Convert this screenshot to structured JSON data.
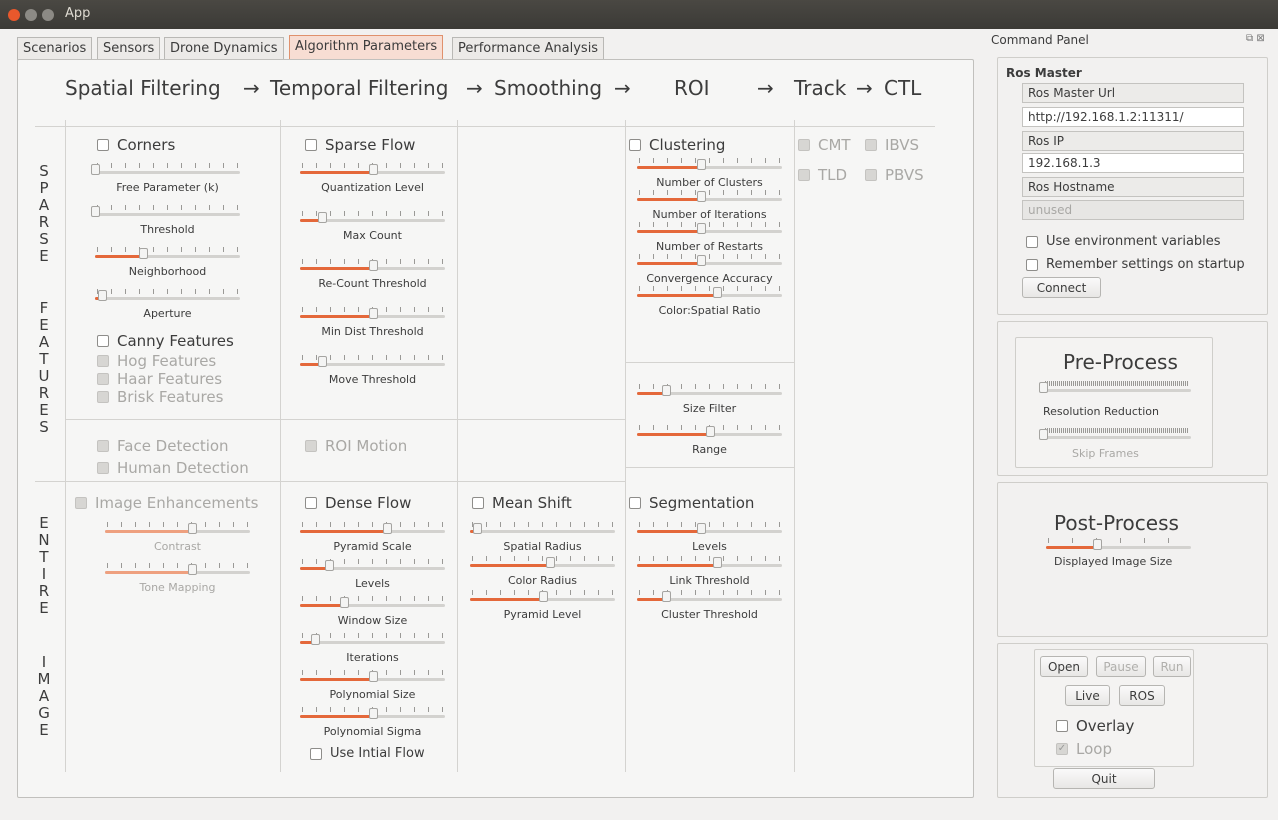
{
  "window": {
    "title": "App"
  },
  "tabs": [
    "Scenarios",
    "Sensors",
    "Drone Dynamics",
    "Algorithm Parameters",
    "Performance Analysis"
  ],
  "active_tab": "Algorithm Parameters",
  "pipeline": [
    "Spatial Filtering",
    "→",
    "Temporal Filtering",
    "→",
    "Smoothing",
    "→",
    "ROI",
    "→",
    "Track",
    "→",
    "CTL"
  ],
  "side_labels": {
    "sparse": "SPARSE",
    "features": "FEATURES",
    "entire": "ENTIRE",
    "image": "IMAGE"
  },
  "spatial": {
    "corners": "Corners",
    "corners_sliders": [
      {
        "label": "Free Parameter (k)",
        "value": 0.0
      },
      {
        "label": "Threshold",
        "value": 0.0
      },
      {
        "label": "Neighborhood",
        "value": 0.33
      },
      {
        "label": "Aperture",
        "value": 0.05
      }
    ],
    "canny": "Canny Features",
    "hog": "Hog Features",
    "haar": "Haar Features",
    "brisk": "Brisk Features",
    "face": "Face Detection",
    "human": "Human Detection",
    "image_enh": "Image Enhancements",
    "enh_sliders": [
      {
        "label": "Contrast",
        "value": 0.6
      },
      {
        "label": "Tone Mapping",
        "value": 0.6
      }
    ]
  },
  "temporal": {
    "sparse_flow": "Sparse Flow",
    "sparse_sliders": [
      {
        "label": "Quantization Level",
        "value": 0.5
      },
      {
        "label": "Max Count",
        "value": 0.15
      },
      {
        "label": "Re-Count Threshold",
        "value": 0.5
      },
      {
        "label": "Min Dist Threshold",
        "value": 0.5
      },
      {
        "label": "Move Threshold",
        "value": 0.15
      }
    ],
    "roi_motion": "ROI Motion",
    "dense_flow": "Dense Flow",
    "dense_sliders": [
      {
        "label": "Pyramid Scale",
        "value": 0.6
      },
      {
        "label": "Levels",
        "value": 0.2
      },
      {
        "label": "Window Size",
        "value": 0.3
      },
      {
        "label": "Iterations",
        "value": 0.1
      },
      {
        "label": "Polynomial Size",
        "value": 0.5
      },
      {
        "label": "Polynomial Sigma",
        "value": 0.5
      }
    ],
    "use_initial_flow": "Use Intial Flow"
  },
  "smoothing": {
    "mean_shift": "Mean Shift",
    "sliders": [
      {
        "label": "Spatial Radius",
        "value": 0.05
      },
      {
        "label": "Color Radius",
        "value": 0.55
      },
      {
        "label": "Pyramid Level",
        "value": 0.5
      }
    ]
  },
  "roi": {
    "clustering": "Clustering",
    "clustering_sliders": [
      {
        "label": "Number of Clusters",
        "value": 0.44
      },
      {
        "label": "Number of Iterations",
        "value": 0.44
      },
      {
        "label": "Number of Restarts",
        "value": 0.44
      },
      {
        "label": "Convergence Accuracy",
        "value": 0.44
      },
      {
        "label": "Color:Spatial Ratio",
        "value": 0.55
      }
    ],
    "filter_sliders": [
      {
        "label": "Size Filter",
        "value": 0.2
      },
      {
        "label": "Range",
        "value": 0.5
      }
    ],
    "segmentation": "Segmentation",
    "segmentation_sliders": [
      {
        "label": "Levels",
        "value": 0.44
      },
      {
        "label": "Link Threshold",
        "value": 0.55
      },
      {
        "label": "Cluster Threshold",
        "value": 0.2
      }
    ]
  },
  "track": {
    "cmt": "CMT",
    "ibvs": "IBVS",
    "tld": "TLD",
    "pbvs": "PBVS"
  },
  "command_panel": {
    "title": "Command Panel",
    "ros_master": "Ros Master",
    "ros_master_url_label": "Ros Master Url",
    "ros_master_url": "http://192.168.1.2:11311/",
    "ros_ip_label": "Ros IP",
    "ros_ip": "192.168.1.3",
    "ros_hostname_label": "Ros Hostname",
    "ros_hostname": "unused",
    "use_env": "Use environment variables",
    "remember": "Remember settings on startup",
    "connect": "Connect",
    "pre_process": "Pre-Process",
    "resolution_reduction": "Resolution Reduction",
    "skip_frames": "Skip Frames",
    "post_process": "Post-Process",
    "displayed_image_size": "Displayed Image Size",
    "displayed_image_size_value": 0.35,
    "open": "Open",
    "pause": "Pause",
    "run": "Run",
    "live": "Live",
    "ros": "ROS",
    "overlay": "Overlay",
    "loop": "Loop",
    "quit": "Quit"
  },
  "colors": {
    "accent": "#e4683a",
    "titlebar": "#3b3a36",
    "active_tab": "#f7ddd3"
  }
}
